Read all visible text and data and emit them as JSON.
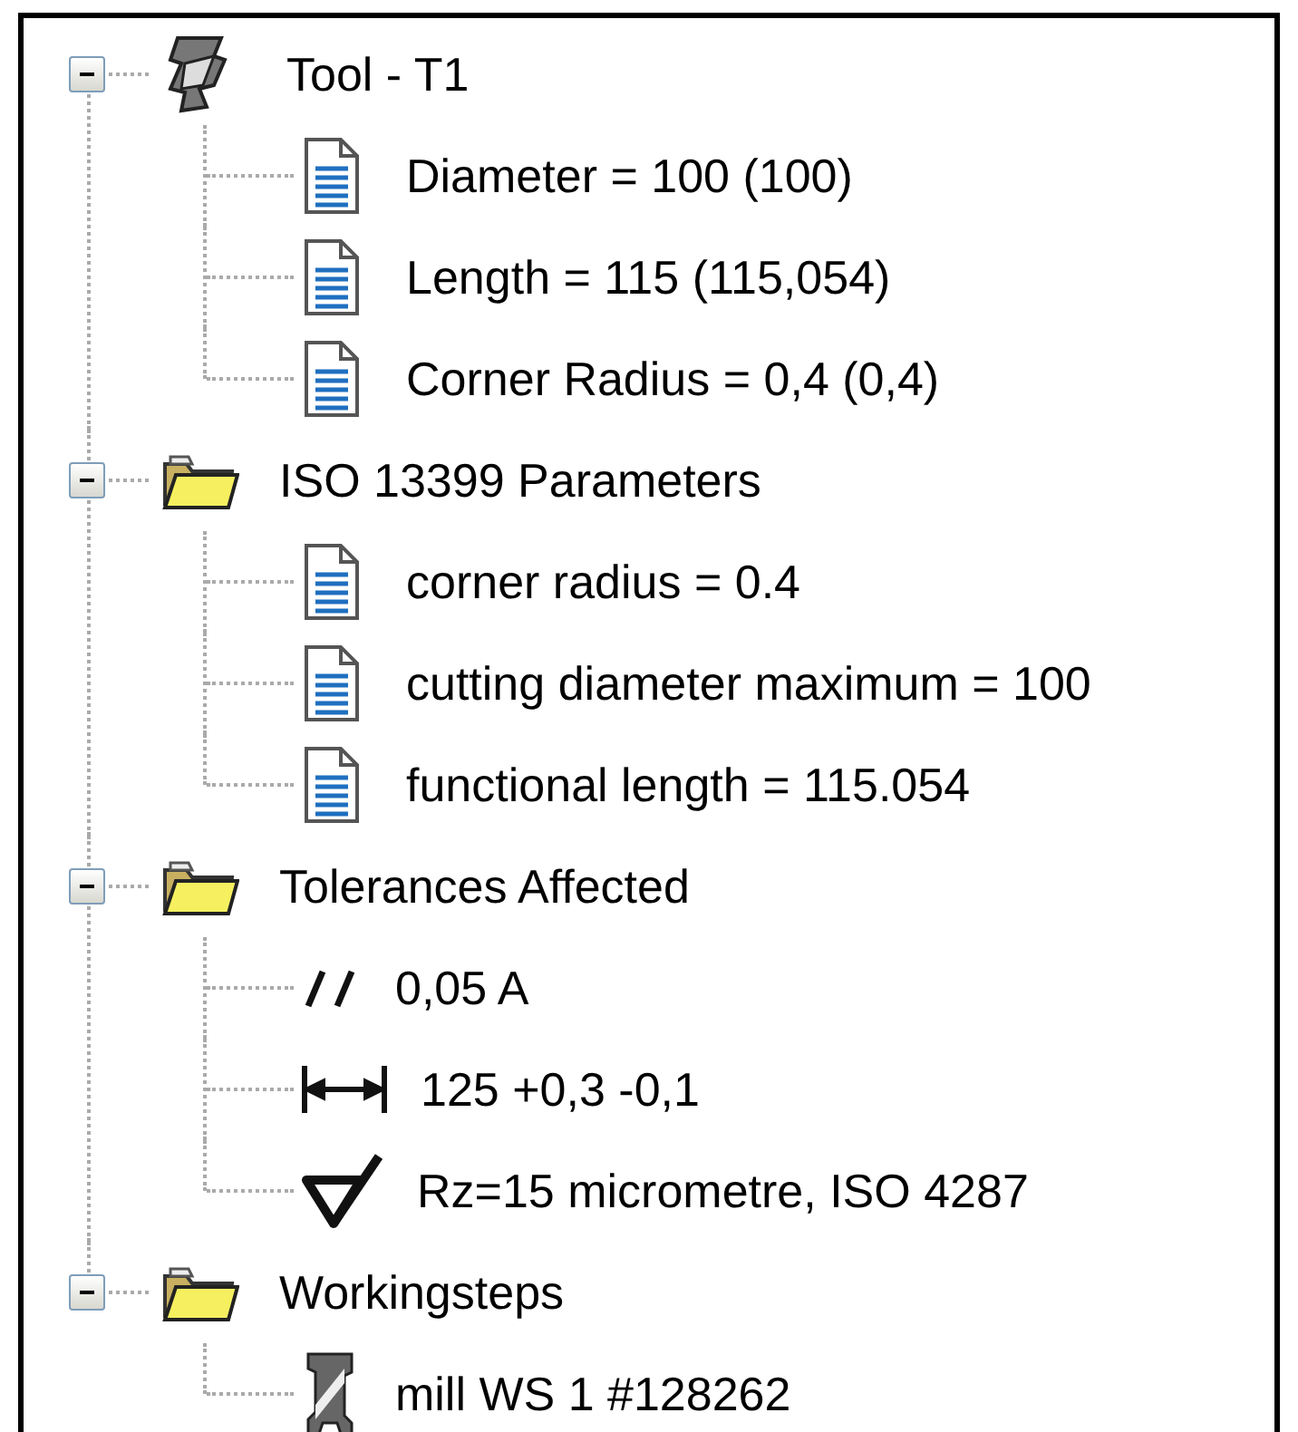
{
  "tree": [
    {
      "label": "Tool - T1",
      "kind": "tool",
      "expanded": true,
      "children": [
        {
          "label": "Diameter = 100 (100)",
          "kind": "doc"
        },
        {
          "label": "Length = 115 (115,054)",
          "kind": "doc"
        },
        {
          "label": "Corner Radius = 0,4 (0,4)",
          "kind": "doc"
        }
      ]
    },
    {
      "label": "ISO 13399 Parameters",
      "kind": "folder",
      "expanded": true,
      "children": [
        {
          "label": "corner radius = 0.4",
          "kind": "doc"
        },
        {
          "label": "cutting diameter maximum = 100",
          "kind": "doc"
        },
        {
          "label": "functional length = 115.054",
          "kind": "doc"
        }
      ]
    },
    {
      "label": "Tolerances Affected",
      "kind": "folder",
      "expanded": true,
      "children": [
        {
          "label": "0,05 A",
          "kind": "parallelism"
        },
        {
          "label": "125 +0,3 -0,1",
          "kind": "dimension"
        },
        {
          "label": "Rz=15 micrometre,  ISO 4287",
          "kind": "surface"
        }
      ]
    },
    {
      "label": "Workingsteps",
      "kind": "folder",
      "expanded": true,
      "children": [
        {
          "label": "mill WS 1 #128262",
          "kind": "mill"
        }
      ]
    }
  ]
}
